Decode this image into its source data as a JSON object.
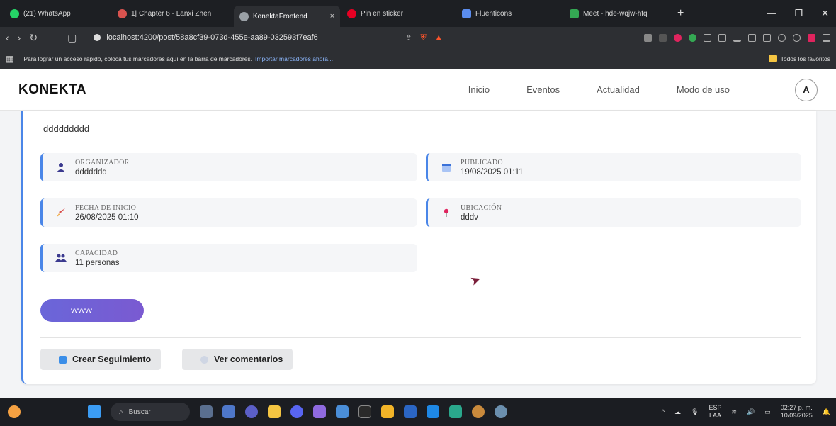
{
  "browser": {
    "tabs": [
      {
        "title": "(21) WhatsApp",
        "color": "#25d366"
      },
      {
        "title": "1| Chapter 6 - Lanxi Zhen",
        "color": "#d9534f"
      },
      {
        "title": "KonektaFrontend",
        "color": "#9aa0a6",
        "active": true
      },
      {
        "title": "Pin en sticker",
        "color": "#e60023"
      },
      {
        "title": "Fluenticons",
        "color": "#5b8def"
      },
      {
        "title": "Meet - hde-wqjw-hfq",
        "color": "#34a853"
      }
    ],
    "new_tab": "+",
    "close_tab": "×",
    "url": "localhost:4200/post/58a8cf39-073d-455e-aa89-032593f7eaf6",
    "bookmarks_text": "Para lograr un acceso rápido, coloca tus marcadores aquí en la barra de marcadores.",
    "bookmarks_link": "Importar marcadores ahora...",
    "all_favorites": "Todos los favoritos"
  },
  "site": {
    "logo": "KONEKTA",
    "nav": [
      "Inicio",
      "Eventos",
      "Actualidad",
      "Modo de uso"
    ],
    "avatar": "A"
  },
  "post": {
    "description": "ddddddddd",
    "fields": {
      "organizer": {
        "label": "ORGANIZADOR",
        "value": "ddddddd"
      },
      "published": {
        "label": "PUBLICADO",
        "value": "19/08/2025 01:11"
      },
      "start": {
        "label": "FECHA DE INICIO",
        "value": "26/08/2025 01:10"
      },
      "location": {
        "label": "UBICACIÓN",
        "value": "dddv"
      },
      "capacity": {
        "label": "CAPACIDAD",
        "value": "11 personas"
      }
    },
    "tag": "vvvvvv",
    "buttons": {
      "follow": "Crear Seguimiento",
      "comments": "Ver comentarios"
    }
  },
  "taskbar": {
    "search": "Buscar",
    "lang": "ESP",
    "lang_sub": "LAA",
    "time": "02:27 p. m.",
    "date": "10/09/2025"
  },
  "colors": {
    "accent": "#4a86e8",
    "tag_gradient_start": "#6a66d9",
    "tag_gradient_end": "#7a5ad1"
  }
}
